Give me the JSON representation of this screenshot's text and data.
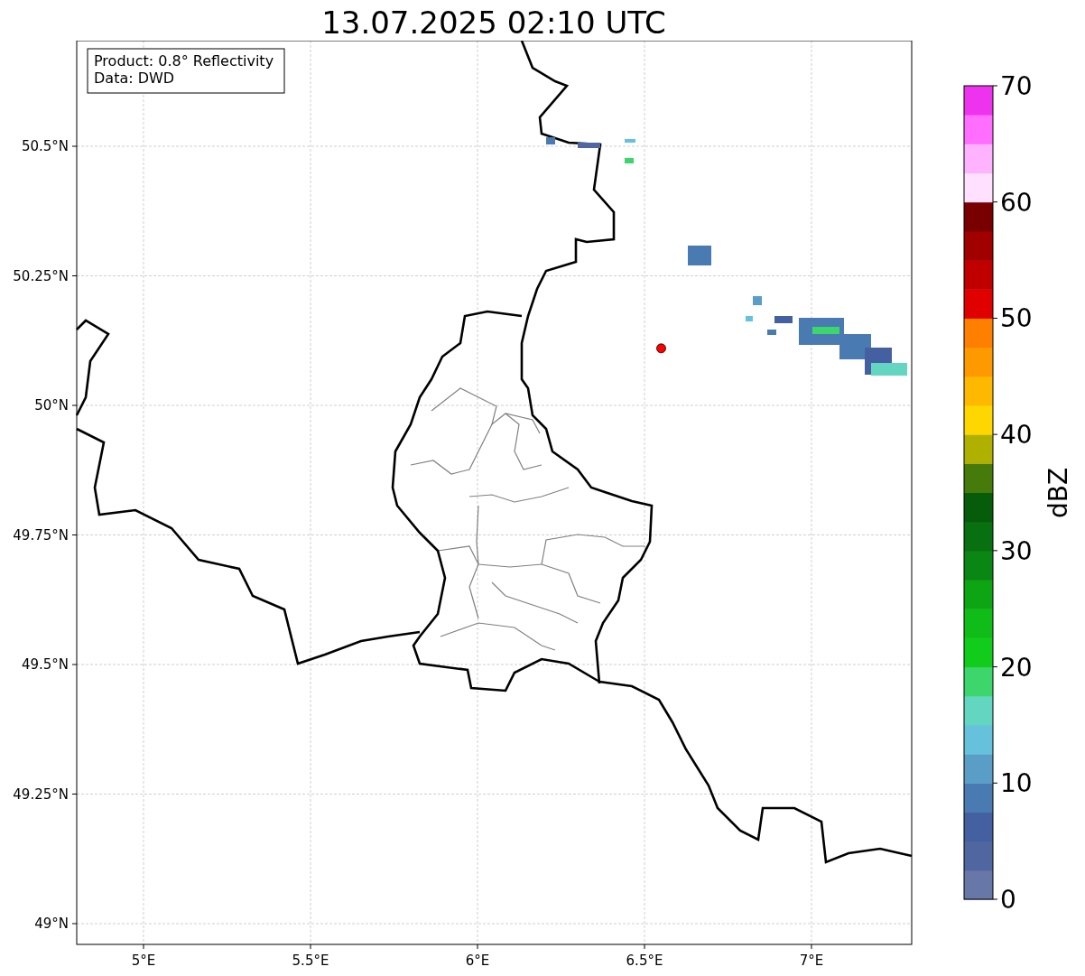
{
  "title": "13.07.2025 02:10 UTC",
  "info_box": [
    "Product: 0.8° Reflectivity",
    "Data: DWD"
  ],
  "map": {
    "x_ticks": [
      "5°E",
      "5.5°E",
      "6°E",
      "6.5°E",
      "7°E"
    ],
    "y_ticks": [
      "50.5°N",
      "50.25°N",
      "50°N",
      "49.75°N",
      "49.5°N",
      "49.25°N",
      "49°N"
    ],
    "radar_site": {
      "color": "#ff0000"
    }
  },
  "colorbar": {
    "label": "dBZ",
    "ticks": [
      "70",
      "60",
      "50",
      "40",
      "30",
      "20",
      "10",
      "0"
    ],
    "levels": [
      {
        "color": "#6677a8"
      },
      {
        "color": "#5066a0"
      },
      {
        "color": "#4460a0"
      },
      {
        "color": "#4a7ab2"
      },
      {
        "color": "#5a9ec8"
      },
      {
        "color": "#66c2dc"
      },
      {
        "color": "#63d6c1"
      },
      {
        "color": "#3cd66c"
      },
      {
        "color": "#12cc1c"
      },
      {
        "color": "#10bc18"
      },
      {
        "color": "#0ea514"
      },
      {
        "color": "#0a8614"
      },
      {
        "color": "#087010"
      },
      {
        "color": "#065c0a"
      },
      {
        "color": "#467a0b"
      },
      {
        "color": "#b0b000"
      },
      {
        "color": "#ffd700"
      },
      {
        "color": "#ffb800"
      },
      {
        "color": "#ff9900"
      },
      {
        "color": "#ff7f00"
      },
      {
        "color": "#e00000"
      },
      {
        "color": "#c00000"
      },
      {
        "color": "#a00000"
      },
      {
        "color": "#780000"
      },
      {
        "color": "#ffe0ff"
      },
      {
        "color": "#ffb3ff"
      },
      {
        "color": "#ff6eff"
      },
      {
        "color": "#ee33ee"
      }
    ]
  }
}
